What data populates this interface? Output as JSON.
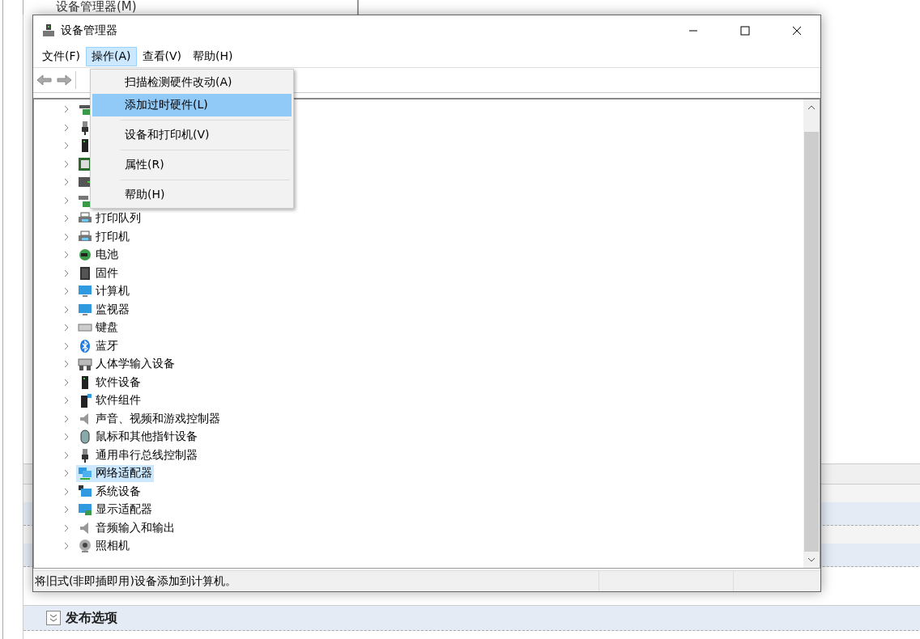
{
  "background_window": {
    "menu_title": "设备管理器(M)",
    "section_title": "发布选项"
  },
  "window": {
    "title": "设备管理器",
    "menu_bar": [
      {
        "label": "文件(F)",
        "selected": false
      },
      {
        "label": "操作(A)",
        "selected": true
      },
      {
        "label": "查看(V)",
        "selected": false
      },
      {
        "label": "帮助(H)",
        "selected": false
      }
    ],
    "dropdown": [
      {
        "label": "扫描检测硬件改动(A)",
        "selected": false,
        "separator_after": false
      },
      {
        "label": "添加过时硬件(L)",
        "selected": true,
        "separator_after": true
      },
      {
        "label": "设备和打印机(V)",
        "selected": false,
        "separator_after": true
      },
      {
        "label": "属性(R)",
        "selected": false,
        "separator_after": true
      },
      {
        "label": "帮助(H)",
        "selected": false,
        "separator_after": false
      }
    ],
    "tree": [
      {
        "kind": "netcard",
        "selected": false,
        "expanded": false
      },
      {
        "kind": "usb",
        "selected": false,
        "expanded": false
      },
      {
        "kind": "tower",
        "selected": false,
        "expanded": false
      },
      {
        "kind": "chip",
        "selected": false,
        "expanded": false
      },
      {
        "kind": "drive",
        "selected": false,
        "expanded": false
      },
      {
        "kind": "storage",
        "selected": false,
        "expanded": false
      },
      {
        "kind": "printer",
        "label": "打印队列",
        "selected": false,
        "expanded": false
      },
      {
        "kind": "printer",
        "label": "打印机",
        "selected": false,
        "expanded": false
      },
      {
        "kind": "battery",
        "label": "电池",
        "selected": false,
        "expanded": false
      },
      {
        "kind": "firmware",
        "label": "固件",
        "selected": false,
        "expanded": false
      },
      {
        "kind": "monitor",
        "label": "计算机",
        "selected": false,
        "expanded": false
      },
      {
        "kind": "monitor",
        "label": "监视器",
        "selected": false,
        "expanded": false
      },
      {
        "kind": "keyboard",
        "label": "键盘",
        "selected": false,
        "expanded": false
      },
      {
        "kind": "bluetooth",
        "label": "蓝牙",
        "selected": false,
        "expanded": false
      },
      {
        "kind": "hid",
        "label": "人体学输入设备",
        "selected": false,
        "expanded": false
      },
      {
        "kind": "tower",
        "label": "软件设备",
        "selected": false,
        "expanded": false
      },
      {
        "kind": "component",
        "label": "软件组件",
        "selected": false,
        "expanded": false
      },
      {
        "kind": "speaker",
        "label": "声音、视频和游戏控制器",
        "selected": false,
        "expanded": false
      },
      {
        "kind": "mouse",
        "label": "鼠标和其他指针设备",
        "selected": false,
        "expanded": false
      },
      {
        "kind": "usb",
        "label": "通用串行总线控制器",
        "selected": false,
        "expanded": false
      },
      {
        "kind": "network",
        "label": "网络适配器",
        "selected": true,
        "expanded": false
      },
      {
        "kind": "system",
        "label": "系统设备",
        "selected": false,
        "expanded": false
      },
      {
        "kind": "display",
        "label": "显示适配器",
        "selected": false,
        "expanded": false
      },
      {
        "kind": "speaker",
        "label": "音频输入和输出",
        "selected": false,
        "expanded": false
      },
      {
        "kind": "camera",
        "label": "照相机",
        "selected": false,
        "expanded": false
      }
    ],
    "status_bar": "将旧式(非即插即用)设备添加到计算机。"
  }
}
